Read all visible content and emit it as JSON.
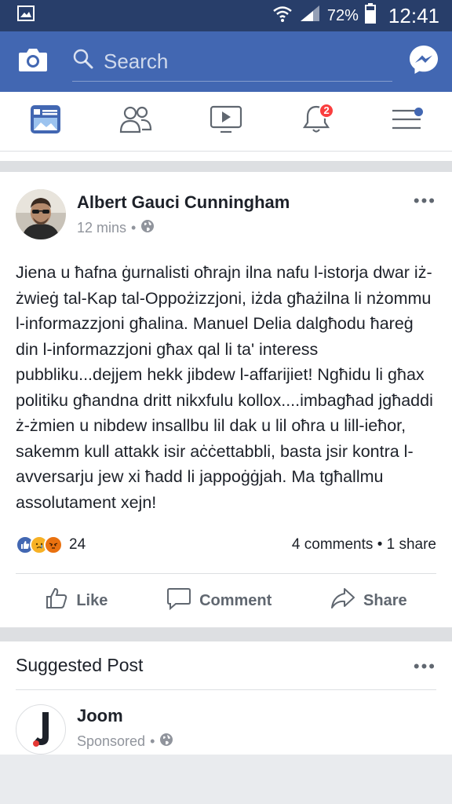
{
  "status_bar": {
    "battery": "72%",
    "time": "12:41"
  },
  "top_bar": {
    "search_placeholder": "Search"
  },
  "nav": {
    "notifications_badge": "2"
  },
  "post": {
    "author": "Albert Gauci Cunningham",
    "time": "12 mins",
    "text": "Jiena u ħafna ġurnalisti oħrajn ilna nafu l-istorja dwar iż-żwieġ tal-Kap tal-Oppożizzjoni, iżda għażilna li nżommu l-informazzjoni għalina. Manuel Delia dalgħodu ħareġ din l-informazzjoni għax qal li ta' interess pubbliku...dejjem hekk jibdew l-affarijiet! Ngħidu li għax politiku għandna dritt nikxfulu kollox....imbagħad jgħaddi ż-żmien u nibdew insallbu lil dak u lil oħra u lill-ieħor, sakemm kull attakk isir aċċettabbli, basta jsir kontra l-avversarju jew xi ħadd li jappoġġjah. Ma tgħallmu assolutament xejn!",
    "reactions_count": "24",
    "comments": "4 comments",
    "shares": "1 share",
    "actions": {
      "like": "Like",
      "comment": "Comment",
      "share": "Share"
    }
  },
  "suggested": {
    "title": "Suggested Post",
    "sponsor_name": "Joom",
    "sponsor_label": "Sponsored"
  },
  "colors": {
    "brand_blue": "#4267b2",
    "status_bar": "#283e6a",
    "badge_red": "#fa3e3e"
  }
}
